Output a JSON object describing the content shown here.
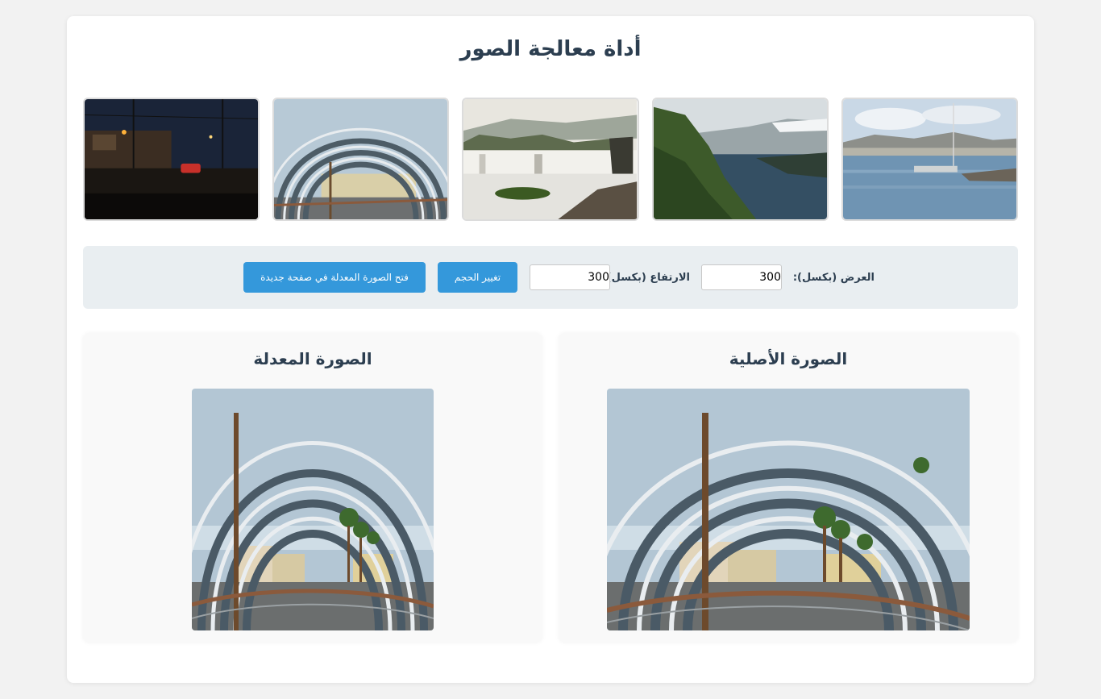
{
  "header": {
    "title": "أداة معالجة الصور"
  },
  "gallery": {
    "items": [
      {
        "icon": "harbor-photo",
        "label": ""
      },
      {
        "icon": "fjord-photo",
        "label": ""
      },
      {
        "icon": "waterfall-photo",
        "label": ""
      },
      {
        "icon": "arch-walkway-photo",
        "label": ""
      },
      {
        "icon": "night-street-photo",
        "label": ""
      }
    ]
  },
  "controls": {
    "width_label": "العرض (بكسل):",
    "width_value": "300",
    "height_label": "الارتفاع (بكسل):",
    "height_value": "300",
    "resize_button": "تغيير الحجم",
    "open_button": "فتح الصورة المعدلة في صفحة جديدة"
  },
  "original": {
    "title": "الصورة الأصلية"
  },
  "edited": {
    "title": "الصورة المعدلة"
  },
  "colors": {
    "accent": "#3498db",
    "title": "#2c3e50",
    "controls_bg": "#e9eef1"
  }
}
